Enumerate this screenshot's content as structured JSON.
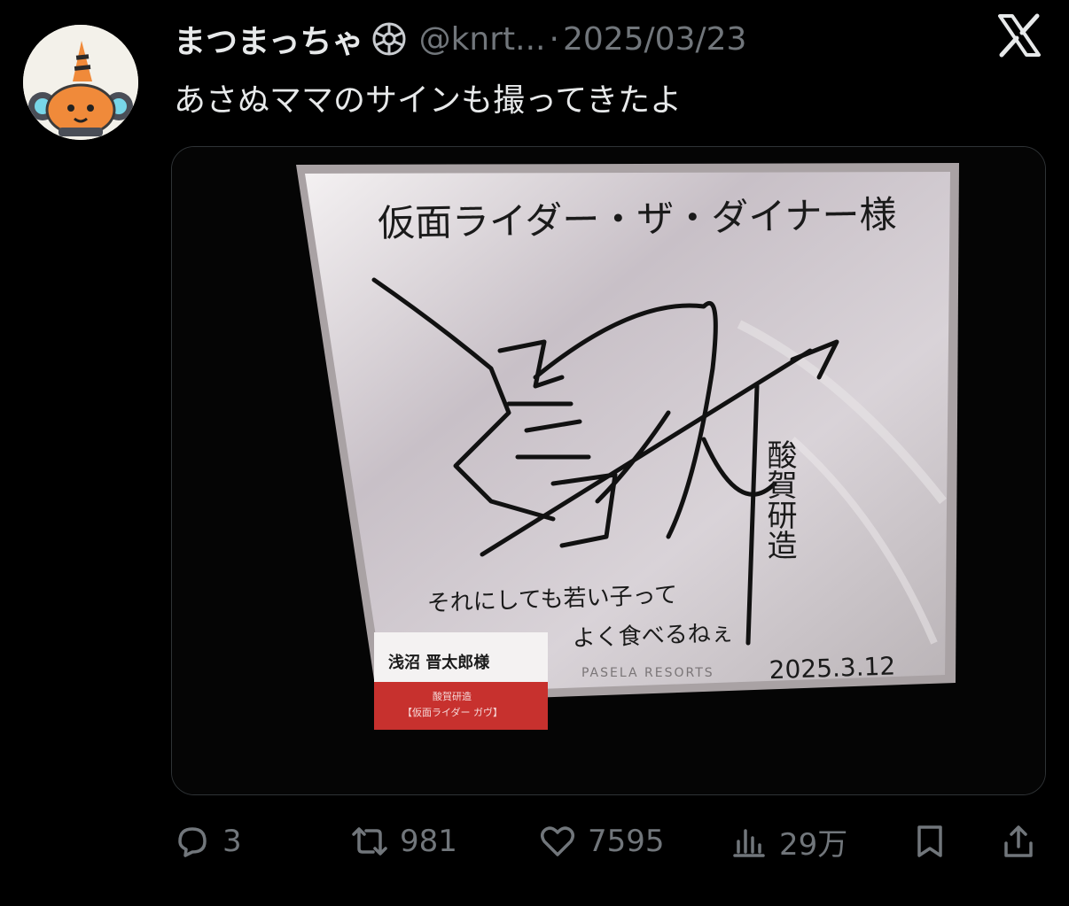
{
  "post": {
    "author": {
      "display_name": "まつまっちゃ",
      "handle": "@knrt...",
      "separator": "·",
      "verified_icon": "badge-icon"
    },
    "date": "2025/03/23",
    "text": "あさぬママのサインも撮ってきたよ",
    "brand_icon": "x-logo-icon"
  },
  "media": {
    "image_text": {
      "top_line": "仮面ライダー・ザ・ダイナー様",
      "right_vertical": "酸賀研造",
      "message_line1": "それにしても若い子って",
      "message_line2": "よく食べるねぇ",
      "date_written": "2025.3.12",
      "brand": "PASELA RESORTS",
      "name_card_title": "浅沼 晋太郎様",
      "name_card_sub1": "酸賀研造",
      "name_card_sub2": "【仮面ライダー ガヴ】"
    }
  },
  "actions": {
    "reply": {
      "icon": "reply-icon",
      "count": "3"
    },
    "repost": {
      "icon": "repost-icon",
      "count": "981"
    },
    "like": {
      "icon": "heart-icon",
      "count": "7595"
    },
    "views": {
      "icon": "views-icon",
      "count": "29万"
    },
    "bookmark": {
      "icon": "bookmark-icon"
    },
    "share": {
      "icon": "share-icon"
    }
  },
  "colors": {
    "background": "#000000",
    "text_primary": "#e7e9ea",
    "text_secondary": "#71767b",
    "avatar_accent": "#f08a3a",
    "card_red": "#c7312e"
  }
}
